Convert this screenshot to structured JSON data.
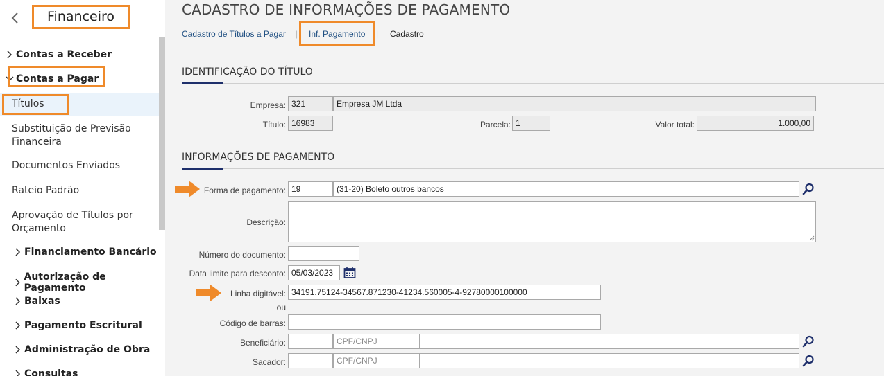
{
  "sidebar": {
    "title": "Financeiro",
    "items": [
      {
        "label": "Contas a Receber"
      },
      {
        "label": "Contas a Pagar"
      },
      {
        "label": "Títulos"
      },
      {
        "label": "Substituição de Previsão Financeira"
      },
      {
        "label": "Documentos Enviados"
      },
      {
        "label": "Rateio Padrão"
      },
      {
        "label": "Aprovação de Títulos por Orçamento"
      },
      {
        "label": "Financiamento Bancário"
      },
      {
        "label": "Autorização de Pagamento"
      },
      {
        "label": "Baixas"
      },
      {
        "label": "Pagamento Escritural"
      },
      {
        "label": "Administração de Obra"
      },
      {
        "label": "Consultas"
      }
    ]
  },
  "page": {
    "title": "CADASTRO DE INFORMAÇÕES DE PAGAMENTO",
    "breadcrumb": [
      "Cadastro de Títulos a Pagar",
      "Inf. Pagamento",
      "Cadastro"
    ]
  },
  "identificacao": {
    "section_title": "IDENTIFICAÇÃO DO TÍTULO",
    "empresa_label": "Empresa:",
    "empresa_code": "321",
    "empresa_name": "Empresa JM Ltda",
    "titulo_label": "Título:",
    "titulo_value": "16983",
    "parcela_label": "Parcela:",
    "parcela_value": "1",
    "valor_label": "Valor total:",
    "valor_value": "1.000,00"
  },
  "pagamento": {
    "section_title": "INFORMAÇÕES DE PAGAMENTO",
    "forma_label": "Forma de pagamento:",
    "forma_code": "19",
    "forma_desc": "(31-20) Boleto outros bancos",
    "descricao_label": "Descrição:",
    "numero_label": "Número do documento:",
    "data_label": "Data limite para desconto:",
    "data_value": "05/03/2023",
    "linha_label": "Linha digitável:",
    "linha_value": "34191.75124-34567.871230-41234.560005-4-92780000100000",
    "ou_label": "ou",
    "codigo_label": "Código de barras:",
    "beneficiario_label": "Beneficiário:",
    "sacador_label": "Sacador:",
    "cpf_placeholder": "CPF/CNPJ"
  },
  "colors": {
    "highlight": "#ef8a2a",
    "link": "#1f4f82",
    "accent": "#1e2f6b"
  }
}
